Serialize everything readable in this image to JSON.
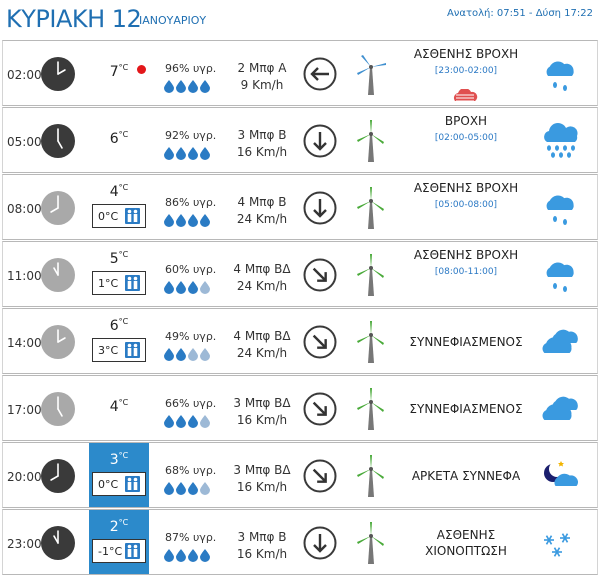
{
  "header": {
    "day": "ΚΥΡΙΑΚΗ 12",
    "month": "ΙΑΝΟΥΑΡΙΟΥ",
    "sun": "Ανατολή: 07:51 - Δύση 17:22"
  },
  "colors": {
    "accent": "#1f6fb2",
    "highlight": "#2c8acb",
    "drop_full": "#2a7bc4",
    "drop_empty": "#9db9d6",
    "turbine_blade_active": "#4aaa3a",
    "turbine_blade_light": "#3f8fcf",
    "cloud": "#3a9ae0",
    "rain_dot": "#e3171a"
  },
  "rows": [
    {
      "time": "02:00",
      "clock": "dark",
      "temp": "7",
      "feels": "",
      "highlight": false,
      "dot": true,
      "hum": "96% υγρ.",
      "drops": 4,
      "wind": "2 Μπφ Α",
      "speed": "9 Km/h",
      "arrow": "left-arrow-icon",
      "turbine": "blue",
      "cond": "ΑΣΘΕΝΗΣ ΒΡΟΧΗ",
      "range": "[23:00-02:00]",
      "haze": true,
      "icon": "light-rain-icon"
    },
    {
      "time": "05:00",
      "clock": "dark",
      "temp": "6",
      "feels": "",
      "highlight": false,
      "dot": false,
      "hum": "92% υγρ.",
      "drops": 4,
      "wind": "3 Μπφ Β",
      "speed": "16 Km/h",
      "arrow": "down-arrow-icon",
      "turbine": "green",
      "cond": "ΒΡΟΧΗ",
      "range": "[02:00-05:00]",
      "haze": false,
      "icon": "rain-icon"
    },
    {
      "time": "08:00",
      "clock": "gray",
      "temp": "4",
      "feels": "0°C",
      "highlight": false,
      "dot": false,
      "hum": "86% υγρ.",
      "drops": 4,
      "wind": "4 Μπφ Β",
      "speed": "24 Km/h",
      "arrow": "down-arrow-icon",
      "turbine": "green",
      "cond": "ΑΣΘΕΝΗΣ ΒΡΟΧΗ",
      "range": "[05:00-08:00]",
      "haze": false,
      "icon": "light-rain-icon"
    },
    {
      "time": "11:00",
      "clock": "gray",
      "temp": "5",
      "feels": "1°C",
      "highlight": false,
      "dot": false,
      "hum": "60% υγρ.",
      "drops": 3,
      "wind": "4 Μπφ ΒΔ",
      "speed": "24 Km/h",
      "arrow": "down-right-arrow-icon",
      "turbine": "green",
      "cond": "ΑΣΘΕΝΗΣ ΒΡΟΧΗ",
      "range": "[08:00-11:00]",
      "haze": false,
      "icon": "light-rain-icon"
    },
    {
      "time": "14:00",
      "clock": "gray",
      "temp": "6",
      "feels": "3°C",
      "highlight": false,
      "dot": false,
      "hum": "49% υγρ.",
      "drops": 2,
      "wind": "4 Μπφ ΒΔ",
      "speed": "24 Km/h",
      "arrow": "down-right-arrow-icon",
      "turbine": "green",
      "cond": "ΣΥΝΝΕΦΙΑΣΜΕΝΟΣ",
      "range": "",
      "haze": false,
      "icon": "cloud-icon"
    },
    {
      "time": "17:00",
      "clock": "gray",
      "temp": "4",
      "feels": "",
      "highlight": false,
      "dot": false,
      "hum": "66% υγρ.",
      "drops": 3,
      "wind": "3 Μπφ ΒΔ",
      "speed": "16 Km/h",
      "arrow": "down-right-arrow-icon",
      "turbine": "green",
      "cond": "ΣΥΝΝΕΦΙΑΣΜΕΝΟΣ",
      "range": "",
      "haze": false,
      "icon": "cloud-icon"
    },
    {
      "time": "20:00",
      "clock": "dark",
      "temp": "3",
      "feels": "0°C",
      "highlight": true,
      "dot": false,
      "hum": "68% υγρ.",
      "drops": 3,
      "wind": "3 Μπφ ΒΔ",
      "speed": "16 Km/h",
      "arrow": "down-right-arrow-icon",
      "turbine": "green",
      "cond": "ΑΡΚΕΤΑ ΣΥΝΝΕΦΑ",
      "range": "",
      "haze": false,
      "icon": "moon-cloud-icon"
    },
    {
      "time": "23:00",
      "clock": "dark",
      "temp": "2",
      "feels": "-1°C",
      "highlight": true,
      "dot": false,
      "hum": "87% υγρ.",
      "drops": 4,
      "wind": "3 Μπφ Β",
      "speed": "16 Km/h",
      "arrow": "down-arrow-icon",
      "turbine": "green",
      "cond": "ΑΣΘΕΝΗΣ\nΧΙΟΝΟΠΤΩΣΗ",
      "range": "",
      "haze": false,
      "icon": "snow-icon"
    }
  ]
}
